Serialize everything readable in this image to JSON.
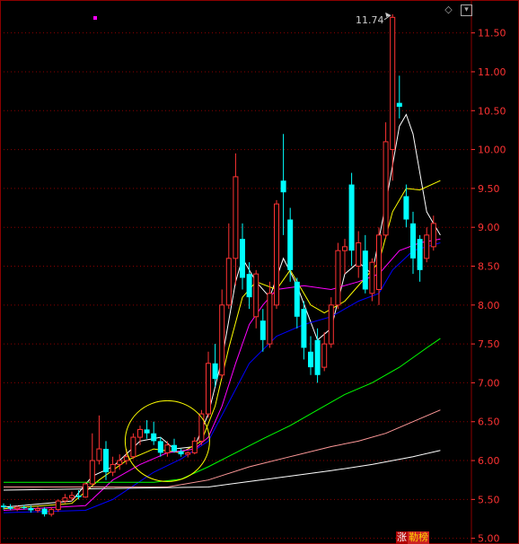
{
  "chart_data": {
    "type": "candlestick",
    "title": "",
    "ylim": [
      4.95,
      11.9
    ],
    "yticks": [
      "5.00",
      "5.50",
      "6.00",
      "6.50",
      "7.00",
      "7.50",
      "8.00",
      "8.50",
      "9.00",
      "9.50",
      "10.00",
      "10.50",
      "11.00",
      "11.50"
    ],
    "high_label": "11.74",
    "grid": true,
    "colors": {
      "up": "#ff3333",
      "down": "#00ffff",
      "grid": "#8b0000",
      "axis_text": "#ff3333"
    },
    "candles": [
      {
        "o": 5.42,
        "h": 5.45,
        "l": 5.37,
        "c": 5.4
      },
      {
        "o": 5.4,
        "h": 5.44,
        "l": 5.36,
        "c": 5.38
      },
      {
        "o": 5.38,
        "h": 5.42,
        "l": 5.35,
        "c": 5.4
      },
      {
        "o": 5.4,
        "h": 5.43,
        "l": 5.37,
        "c": 5.39
      },
      {
        "o": 5.39,
        "h": 5.42,
        "l": 5.33,
        "c": 5.36
      },
      {
        "o": 5.36,
        "h": 5.41,
        "l": 5.33,
        "c": 5.38
      },
      {
        "o": 5.38,
        "h": 5.4,
        "l": 5.28,
        "c": 5.31
      },
      {
        "o": 5.31,
        "h": 5.4,
        "l": 5.28,
        "c": 5.37
      },
      {
        "o": 5.37,
        "h": 5.5,
        "l": 5.34,
        "c": 5.48
      },
      {
        "o": 5.48,
        "h": 5.57,
        "l": 5.45,
        "c": 5.52
      },
      {
        "o": 5.52,
        "h": 5.6,
        "l": 5.48,
        "c": 5.55
      },
      {
        "o": 5.55,
        "h": 5.62,
        "l": 5.5,
        "c": 5.53
      },
      {
        "o": 5.53,
        "h": 5.72,
        "l": 5.52,
        "c": 5.7
      },
      {
        "o": 5.7,
        "h": 6.35,
        "l": 5.68,
        "c": 6.0
      },
      {
        "o": 6.0,
        "h": 6.58,
        "l": 5.95,
        "c": 6.15
      },
      {
        "o": 6.15,
        "h": 6.25,
        "l": 5.75,
        "c": 5.85
      },
      {
        "o": 5.85,
        "h": 6.05,
        "l": 5.8,
        "c": 5.95
      },
      {
        "o": 5.95,
        "h": 6.08,
        "l": 5.88,
        "c": 6.0
      },
      {
        "o": 6.0,
        "h": 6.15,
        "l": 5.95,
        "c": 6.05
      },
      {
        "o": 6.05,
        "h": 6.35,
        "l": 6.02,
        "c": 6.3
      },
      {
        "o": 6.3,
        "h": 6.45,
        "l": 6.2,
        "c": 6.4
      },
      {
        "o": 6.4,
        "h": 6.52,
        "l": 6.28,
        "c": 6.35
      },
      {
        "o": 6.35,
        "h": 6.5,
        "l": 6.2,
        "c": 6.25
      },
      {
        "o": 6.25,
        "h": 6.3,
        "l": 6.05,
        "c": 6.1
      },
      {
        "o": 6.1,
        "h": 6.25,
        "l": 6.05,
        "c": 6.2
      },
      {
        "o": 6.2,
        "h": 6.28,
        "l": 6.1,
        "c": 6.12
      },
      {
        "o": 6.12,
        "h": 6.15,
        "l": 6.05,
        "c": 6.08
      },
      {
        "o": 6.08,
        "h": 6.12,
        "l": 6.04,
        "c": 6.1
      },
      {
        "o": 6.1,
        "h": 6.3,
        "l": 6.08,
        "c": 6.25
      },
      {
        "o": 6.25,
        "h": 6.65,
        "l": 6.2,
        "c": 6.6
      },
      {
        "o": 6.6,
        "h": 7.4,
        "l": 6.55,
        "c": 7.25
      },
      {
        "o": 7.25,
        "h": 7.5,
        "l": 6.95,
        "c": 7.05
      },
      {
        "o": 7.1,
        "h": 8.2,
        "l": 7.05,
        "c": 8.0
      },
      {
        "o": 8.0,
        "h": 9.05,
        "l": 7.95,
        "c": 8.6
      },
      {
        "o": 8.6,
        "h": 9.95,
        "l": 8.25,
        "c": 9.65
      },
      {
        "o": 8.85,
        "h": 9.05,
        "l": 8.2,
        "c": 8.35
      },
      {
        "o": 8.4,
        "h": 8.55,
        "l": 7.95,
        "c": 8.1
      },
      {
        "o": 7.85,
        "h": 8.45,
        "l": 7.7,
        "c": 8.4
      },
      {
        "o": 7.8,
        "h": 7.95,
        "l": 7.4,
        "c": 7.55
      },
      {
        "o": 7.5,
        "h": 8.3,
        "l": 7.45,
        "c": 8.15
      },
      {
        "o": 8.0,
        "h": 9.35,
        "l": 7.95,
        "c": 9.3
      },
      {
        "o": 9.6,
        "h": 10.2,
        "l": 8.9,
        "c": 9.45
      },
      {
        "o": 9.1,
        "h": 9.25,
        "l": 8.3,
        "c": 8.45
      },
      {
        "o": 8.3,
        "h": 8.35,
        "l": 7.7,
        "c": 7.85
      },
      {
        "o": 7.95,
        "h": 8.05,
        "l": 7.3,
        "c": 7.45
      },
      {
        "o": 7.4,
        "h": 7.6,
        "l": 7.1,
        "c": 7.2
      },
      {
        "o": 7.55,
        "h": 7.7,
        "l": 7.0,
        "c": 7.1
      },
      {
        "o": 7.2,
        "h": 7.65,
        "l": 7.15,
        "c": 7.5
      },
      {
        "o": 7.5,
        "h": 8.1,
        "l": 7.45,
        "c": 8.0
      },
      {
        "o": 8.0,
        "h": 8.8,
        "l": 7.95,
        "c": 8.7
      },
      {
        "o": 8.7,
        "h": 8.85,
        "l": 8.4,
        "c": 8.75
      },
      {
        "o": 9.55,
        "h": 9.7,
        "l": 8.5,
        "c": 8.7
      },
      {
        "o": 8.5,
        "h": 8.95,
        "l": 8.35,
        "c": 8.8
      },
      {
        "o": 8.7,
        "h": 8.9,
        "l": 8.15,
        "c": 8.2
      },
      {
        "o": 8.15,
        "h": 8.6,
        "l": 8.05,
        "c": 8.55
      },
      {
        "o": 8.2,
        "h": 9.0,
        "l": 8.0,
        "c": 8.9
      },
      {
        "o": 8.9,
        "h": 10.35,
        "l": 8.85,
        "c": 10.1
      },
      {
        "o": 10.0,
        "h": 11.74,
        "l": 9.6,
        "c": 11.7
      },
      {
        "o": 10.6,
        "h": 10.95,
        "l": 10.4,
        "c": 10.55
      },
      {
        "o": 9.4,
        "h": 9.55,
        "l": 9.0,
        "c": 9.1
      },
      {
        "o": 9.05,
        "h": 9.2,
        "l": 8.4,
        "c": 8.6
      },
      {
        "o": 8.85,
        "h": 8.9,
        "l": 8.3,
        "c": 8.45
      },
      {
        "o": 8.6,
        "h": 9.0,
        "l": 8.55,
        "c": 8.9
      },
      {
        "o": 8.75,
        "h": 9.15,
        "l": 8.7,
        "c": 9.05
      }
    ],
    "moving_averages": [
      {
        "color": "#ffffff",
        "points": [
          [
            0,
            5.4
          ],
          [
            10,
            5.48
          ],
          [
            13,
            5.8
          ],
          [
            16,
            5.92
          ],
          [
            20,
            6.25
          ],
          [
            23,
            6.3
          ],
          [
            25,
            6.15
          ],
          [
            28,
            6.18
          ],
          [
            30,
            6.6
          ],
          [
            32,
            7.3
          ],
          [
            34,
            8.3
          ],
          [
            35,
            8.6
          ],
          [
            37,
            8.3
          ],
          [
            39,
            8.1
          ],
          [
            41,
            8.6
          ],
          [
            43,
            8.25
          ],
          [
            46,
            7.55
          ],
          [
            48,
            7.7
          ],
          [
            50,
            8.4
          ],
          [
            52,
            8.55
          ],
          [
            54,
            8.4
          ],
          [
            56,
            9.3
          ],
          [
            58,
            10.3
          ],
          [
            59,
            10.45
          ],
          [
            60,
            10.2
          ],
          [
            62,
            9.2
          ],
          [
            64,
            8.9
          ]
        ]
      },
      {
        "color": "#ffff00",
        "points": [
          [
            0,
            5.38
          ],
          [
            10,
            5.45
          ],
          [
            14,
            5.75
          ],
          [
            18,
            6.0
          ],
          [
            22,
            6.15
          ],
          [
            26,
            6.1
          ],
          [
            29,
            6.25
          ],
          [
            31,
            6.7
          ],
          [
            33,
            7.45
          ],
          [
            35,
            8.1
          ],
          [
            37,
            8.3
          ],
          [
            40,
            8.2
          ],
          [
            42,
            8.45
          ],
          [
            45,
            8.0
          ],
          [
            47,
            7.9
          ],
          [
            50,
            8.05
          ],
          [
            53,
            8.35
          ],
          [
            55,
            8.55
          ],
          [
            57,
            9.2
          ],
          [
            59,
            9.5
          ],
          [
            61,
            9.48
          ],
          [
            64,
            9.6
          ]
        ]
      },
      {
        "color": "#ff00ff",
        "points": [
          [
            0,
            5.36
          ],
          [
            12,
            5.42
          ],
          [
            16,
            5.75
          ],
          [
            20,
            5.95
          ],
          [
            24,
            6.1
          ],
          [
            28,
            6.15
          ],
          [
            30,
            6.3
          ],
          [
            32,
            6.7
          ],
          [
            34,
            7.25
          ],
          [
            36,
            7.75
          ],
          [
            38,
            8.0
          ],
          [
            40,
            8.2
          ],
          [
            44,
            8.25
          ],
          [
            48,
            8.2
          ],
          [
            52,
            8.3
          ],
          [
            55,
            8.4
          ],
          [
            58,
            8.7
          ],
          [
            61,
            8.8
          ],
          [
            64,
            8.85
          ]
        ]
      },
      {
        "color": "#0000ff",
        "points": [
          [
            0,
            5.33
          ],
          [
            12,
            5.36
          ],
          [
            16,
            5.5
          ],
          [
            22,
            5.85
          ],
          [
            26,
            6.02
          ],
          [
            30,
            6.25
          ],
          [
            33,
            6.75
          ],
          [
            36,
            7.25
          ],
          [
            40,
            7.6
          ],
          [
            44,
            7.75
          ],
          [
            48,
            7.85
          ],
          [
            52,
            8.05
          ],
          [
            55,
            8.15
          ],
          [
            57,
            8.45
          ],
          [
            60,
            8.7
          ],
          [
            64,
            8.8
          ]
        ]
      },
      {
        "color": "#00ff00",
        "points": [
          [
            0,
            5.72
          ],
          [
            14,
            5.72
          ],
          [
            22,
            5.72
          ],
          [
            26,
            5.76
          ],
          [
            30,
            5.92
          ],
          [
            34,
            6.1
          ],
          [
            38,
            6.28
          ],
          [
            42,
            6.45
          ],
          [
            46,
            6.65
          ],
          [
            50,
            6.85
          ],
          [
            54,
            7.0
          ],
          [
            58,
            7.2
          ],
          [
            62,
            7.45
          ],
          [
            64,
            7.57
          ]
        ]
      },
      {
        "color": "#ff9999",
        "points": [
          [
            0,
            5.66
          ],
          [
            16,
            5.66
          ],
          [
            24,
            5.66
          ],
          [
            30,
            5.75
          ],
          [
            36,
            5.92
          ],
          [
            42,
            6.05
          ],
          [
            48,
            6.18
          ],
          [
            52,
            6.25
          ],
          [
            56,
            6.35
          ],
          [
            60,
            6.5
          ],
          [
            64,
            6.65
          ]
        ]
      },
      {
        "color": "#ffffff",
        "points": [
          [
            0,
            5.62
          ],
          [
            30,
            5.66
          ],
          [
            36,
            5.73
          ],
          [
            42,
            5.8
          ],
          [
            48,
            5.87
          ],
          [
            54,
            5.95
          ],
          [
            60,
            6.05
          ],
          [
            64,
            6.13
          ]
        ]
      }
    ]
  },
  "badge": {
    "left": "涨",
    "right": "勒榜"
  },
  "icons": {
    "diamond": "diamond-icon",
    "menu": "menu-icon",
    "marker": "marker-dot"
  }
}
